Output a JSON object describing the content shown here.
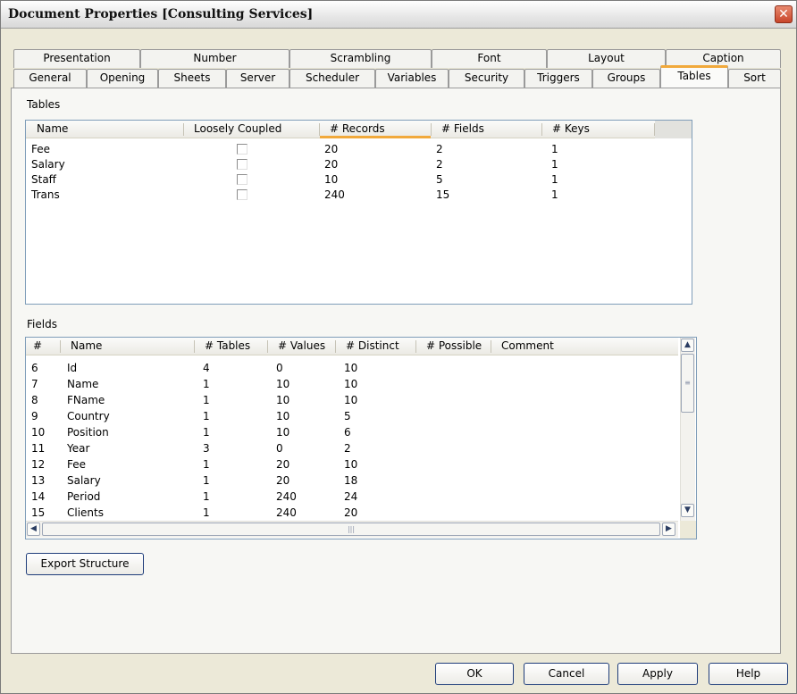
{
  "window": {
    "title": "Document Properties [Consulting Services]",
    "close_glyph": "✕"
  },
  "tabs_row1": [
    "Presentation",
    "Number",
    "Scrambling",
    "Font",
    "Layout",
    "Caption"
  ],
  "tabs_row2": [
    "General",
    "Opening",
    "Sheets",
    "Server",
    "Scheduler",
    "Variables",
    "Security",
    "Triggers",
    "Groups",
    "Tables",
    "Sort"
  ],
  "active_tab": "Tables",
  "tables_section": {
    "label": "Tables",
    "columns": [
      "Name",
      "Loosely Coupled",
      "# Records",
      "# Fields",
      "# Keys"
    ],
    "sorted_column": "# Records",
    "rows": [
      {
        "name": "Fee",
        "loosely_coupled": false,
        "records": "20",
        "fields": "2",
        "keys": "1"
      },
      {
        "name": "Salary",
        "loosely_coupled": false,
        "records": "20",
        "fields": "2",
        "keys": "1"
      },
      {
        "name": "Staff",
        "loosely_coupled": false,
        "records": "10",
        "fields": "5",
        "keys": "1"
      },
      {
        "name": "Trans",
        "loosely_coupled": false,
        "records": "240",
        "fields": "15",
        "keys": "1"
      }
    ]
  },
  "fields_section": {
    "label": "Fields",
    "columns": [
      "#",
      "Name",
      "# Tables",
      "# Values",
      "# Distinct",
      "# Possible",
      "Comment"
    ],
    "rows": [
      {
        "num": "6",
        "name": "Id",
        "tables": "4",
        "values": "0",
        "distinct": "10"
      },
      {
        "num": "7",
        "name": "Name",
        "tables": "1",
        "values": "10",
        "distinct": "10"
      },
      {
        "num": "8",
        "name": "FName",
        "tables": "1",
        "values": "10",
        "distinct": "10"
      },
      {
        "num": "9",
        "name": "Country",
        "tables": "1",
        "values": "10",
        "distinct": "5"
      },
      {
        "num": "10",
        "name": "Position",
        "tables": "1",
        "values": "10",
        "distinct": "6"
      },
      {
        "num": "11",
        "name": "Year",
        "tables": "3",
        "values": "0",
        "distinct": "2"
      },
      {
        "num": "12",
        "name": "Fee",
        "tables": "1",
        "values": "20",
        "distinct": "10"
      },
      {
        "num": "13",
        "name": "Salary",
        "tables": "1",
        "values": "20",
        "distinct": "18"
      },
      {
        "num": "14",
        "name": "Period",
        "tables": "1",
        "values": "240",
        "distinct": "24"
      },
      {
        "num": "15",
        "name": "Clients",
        "tables": "1",
        "values": "240",
        "distinct": "20"
      }
    ],
    "scroll_icons": {
      "up": "▲",
      "down": "▼",
      "left": "◀",
      "right": "▶",
      "grip_v": "≡",
      "grip_h": "|||"
    }
  },
  "export_button": "Export Structure",
  "footer_buttons": [
    "OK",
    "Cancel",
    "Apply",
    "Help"
  ],
  "colors": {
    "active_tab_accent": "#f1a93b",
    "close_button": "#c8452a",
    "list_border": "#7f9db9"
  }
}
